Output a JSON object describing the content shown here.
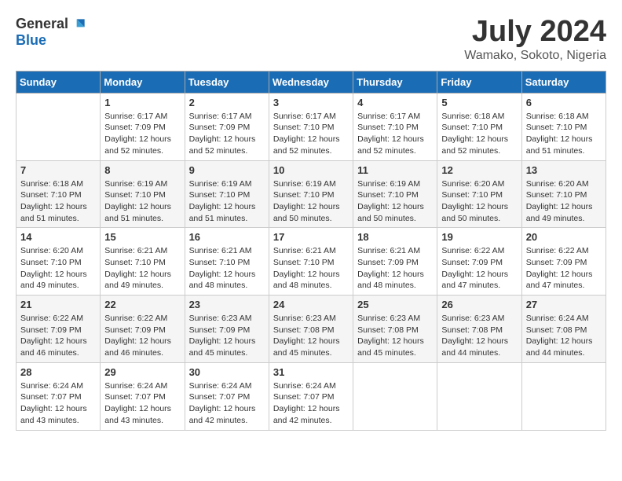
{
  "header": {
    "logo_general": "General",
    "logo_blue": "Blue",
    "month_year": "July 2024",
    "location": "Wamako, Sokoto, Nigeria"
  },
  "days_of_week": [
    "Sunday",
    "Monday",
    "Tuesday",
    "Wednesday",
    "Thursday",
    "Friday",
    "Saturday"
  ],
  "weeks": [
    [
      {
        "num": "",
        "sunrise": "",
        "sunset": "",
        "daylight": ""
      },
      {
        "num": "1",
        "sunrise": "6:17 AM",
        "sunset": "7:09 PM",
        "daylight": "12 hours and 52 minutes."
      },
      {
        "num": "2",
        "sunrise": "6:17 AM",
        "sunset": "7:09 PM",
        "daylight": "12 hours and 52 minutes."
      },
      {
        "num": "3",
        "sunrise": "6:17 AM",
        "sunset": "7:10 PM",
        "daylight": "12 hours and 52 minutes."
      },
      {
        "num": "4",
        "sunrise": "6:17 AM",
        "sunset": "7:10 PM",
        "daylight": "12 hours and 52 minutes."
      },
      {
        "num": "5",
        "sunrise": "6:18 AM",
        "sunset": "7:10 PM",
        "daylight": "12 hours and 52 minutes."
      },
      {
        "num": "6",
        "sunrise": "6:18 AM",
        "sunset": "7:10 PM",
        "daylight": "12 hours and 51 minutes."
      }
    ],
    [
      {
        "num": "7",
        "sunrise": "6:18 AM",
        "sunset": "7:10 PM",
        "daylight": "12 hours and 51 minutes."
      },
      {
        "num": "8",
        "sunrise": "6:19 AM",
        "sunset": "7:10 PM",
        "daylight": "12 hours and 51 minutes."
      },
      {
        "num": "9",
        "sunrise": "6:19 AM",
        "sunset": "7:10 PM",
        "daylight": "12 hours and 51 minutes."
      },
      {
        "num": "10",
        "sunrise": "6:19 AM",
        "sunset": "7:10 PM",
        "daylight": "12 hours and 50 minutes."
      },
      {
        "num": "11",
        "sunrise": "6:19 AM",
        "sunset": "7:10 PM",
        "daylight": "12 hours and 50 minutes."
      },
      {
        "num": "12",
        "sunrise": "6:20 AM",
        "sunset": "7:10 PM",
        "daylight": "12 hours and 50 minutes."
      },
      {
        "num": "13",
        "sunrise": "6:20 AM",
        "sunset": "7:10 PM",
        "daylight": "12 hours and 49 minutes."
      }
    ],
    [
      {
        "num": "14",
        "sunrise": "6:20 AM",
        "sunset": "7:10 PM",
        "daylight": "12 hours and 49 minutes."
      },
      {
        "num": "15",
        "sunrise": "6:21 AM",
        "sunset": "7:10 PM",
        "daylight": "12 hours and 49 minutes."
      },
      {
        "num": "16",
        "sunrise": "6:21 AM",
        "sunset": "7:10 PM",
        "daylight": "12 hours and 48 minutes."
      },
      {
        "num": "17",
        "sunrise": "6:21 AM",
        "sunset": "7:10 PM",
        "daylight": "12 hours and 48 minutes."
      },
      {
        "num": "18",
        "sunrise": "6:21 AM",
        "sunset": "7:09 PM",
        "daylight": "12 hours and 48 minutes."
      },
      {
        "num": "19",
        "sunrise": "6:22 AM",
        "sunset": "7:09 PM",
        "daylight": "12 hours and 47 minutes."
      },
      {
        "num": "20",
        "sunrise": "6:22 AM",
        "sunset": "7:09 PM",
        "daylight": "12 hours and 47 minutes."
      }
    ],
    [
      {
        "num": "21",
        "sunrise": "6:22 AM",
        "sunset": "7:09 PM",
        "daylight": "12 hours and 46 minutes."
      },
      {
        "num": "22",
        "sunrise": "6:22 AM",
        "sunset": "7:09 PM",
        "daylight": "12 hours and 46 minutes."
      },
      {
        "num": "23",
        "sunrise": "6:23 AM",
        "sunset": "7:09 PM",
        "daylight": "12 hours and 45 minutes."
      },
      {
        "num": "24",
        "sunrise": "6:23 AM",
        "sunset": "7:08 PM",
        "daylight": "12 hours and 45 minutes."
      },
      {
        "num": "25",
        "sunrise": "6:23 AM",
        "sunset": "7:08 PM",
        "daylight": "12 hours and 45 minutes."
      },
      {
        "num": "26",
        "sunrise": "6:23 AM",
        "sunset": "7:08 PM",
        "daylight": "12 hours and 44 minutes."
      },
      {
        "num": "27",
        "sunrise": "6:24 AM",
        "sunset": "7:08 PM",
        "daylight": "12 hours and 44 minutes."
      }
    ],
    [
      {
        "num": "28",
        "sunrise": "6:24 AM",
        "sunset": "7:07 PM",
        "daylight": "12 hours and 43 minutes."
      },
      {
        "num": "29",
        "sunrise": "6:24 AM",
        "sunset": "7:07 PM",
        "daylight": "12 hours and 43 minutes."
      },
      {
        "num": "30",
        "sunrise": "6:24 AM",
        "sunset": "7:07 PM",
        "daylight": "12 hours and 42 minutes."
      },
      {
        "num": "31",
        "sunrise": "6:24 AM",
        "sunset": "7:07 PM",
        "daylight": "12 hours and 42 minutes."
      },
      {
        "num": "",
        "sunrise": "",
        "sunset": "",
        "daylight": ""
      },
      {
        "num": "",
        "sunrise": "",
        "sunset": "",
        "daylight": ""
      },
      {
        "num": "",
        "sunrise": "",
        "sunset": "",
        "daylight": ""
      }
    ]
  ]
}
